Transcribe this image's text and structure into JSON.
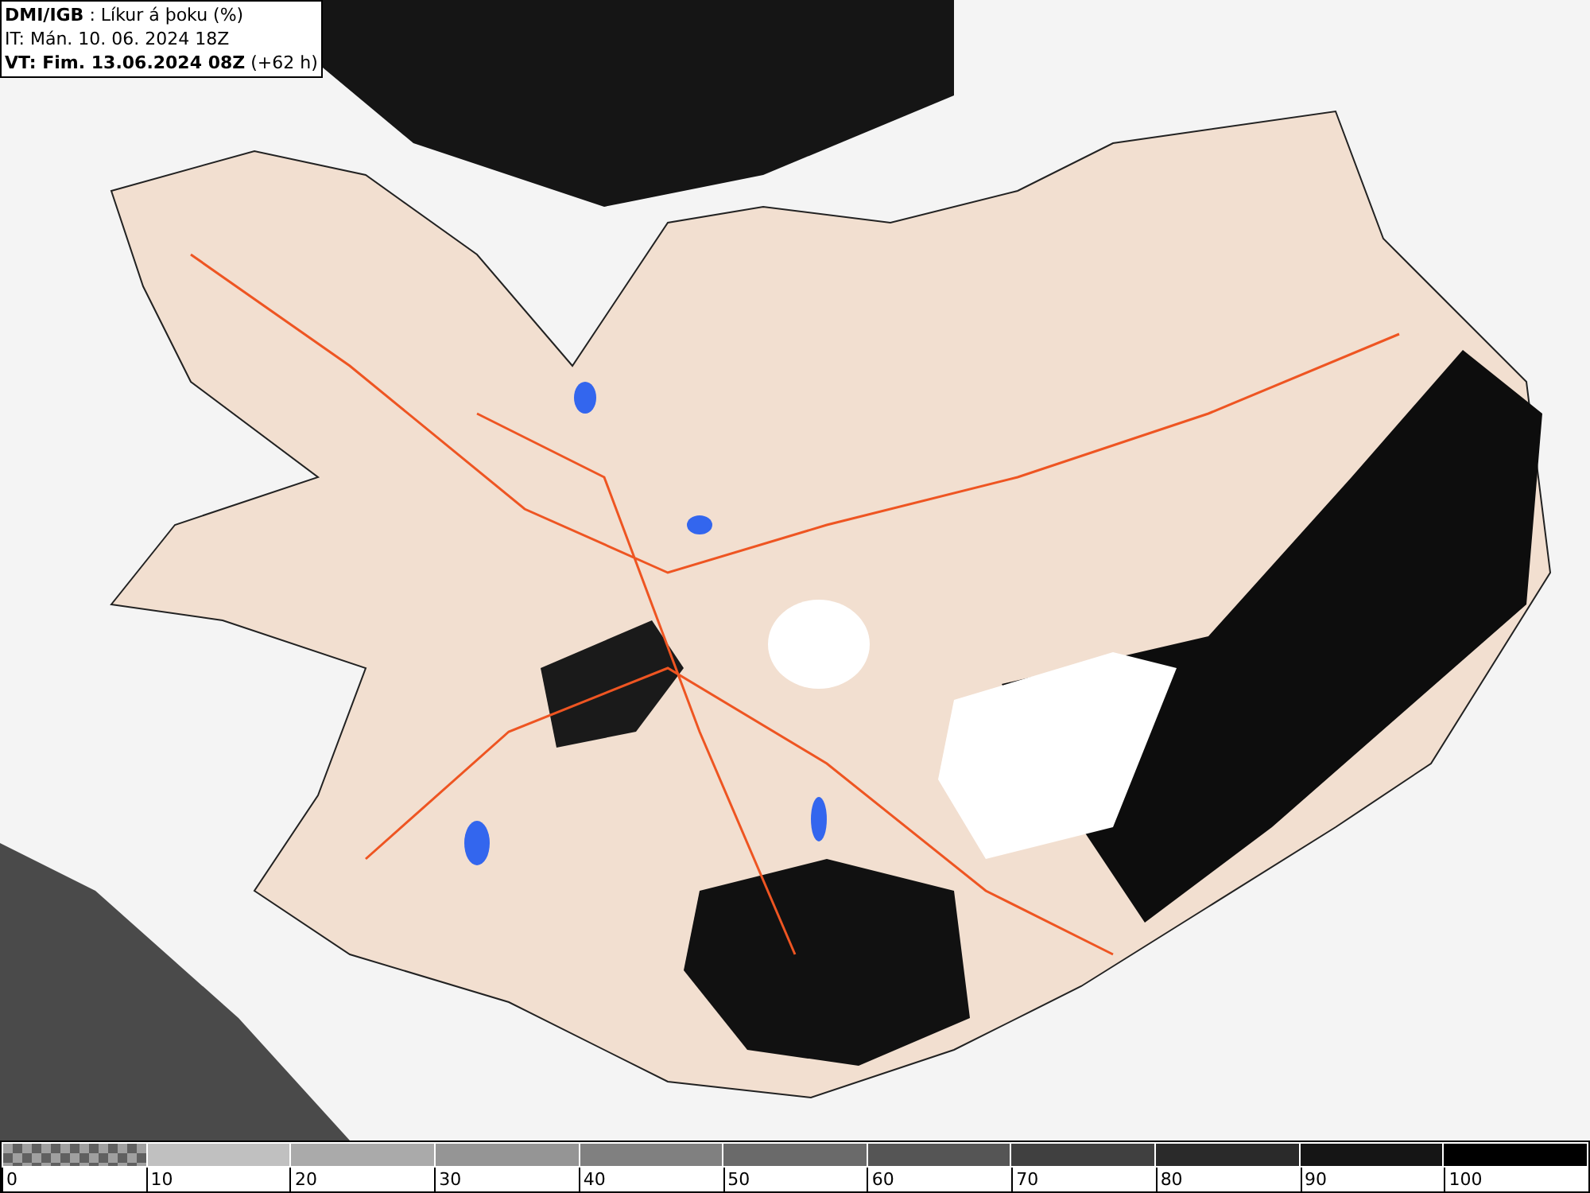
{
  "header": {
    "lines": [
      "**DMI/IGB** : Líkur á þoku (%)",
      "IT: Mán. 10. 06. 2024 18Z",
      "**VT: Fim. 13.06.2024 08Z** (+62 h)"
    ]
  },
  "legend": {
    "segments": [
      {
        "kind": "checker",
        "color": "#a0a0a0"
      },
      {
        "kind": "solid",
        "color": "#c0c0c0"
      },
      {
        "kind": "solid",
        "color": "#aaaaaa"
      },
      {
        "kind": "solid",
        "color": "#959595"
      },
      {
        "kind": "solid",
        "color": "#808080"
      },
      {
        "kind": "solid",
        "color": "#6a6a6a"
      },
      {
        "kind": "solid",
        "color": "#555555"
      },
      {
        "kind": "solid",
        "color": "#404040"
      },
      {
        "kind": "solid",
        "color": "#2a2a2a"
      },
      {
        "kind": "solid",
        "color": "#151515"
      },
      {
        "kind": "solid",
        "color": "#000000"
      }
    ],
    "ticks": [
      "0",
      "10",
      "20",
      "30",
      "40",
      "50",
      "60",
      "70",
      "80",
      "90",
      "100"
    ]
  }
}
